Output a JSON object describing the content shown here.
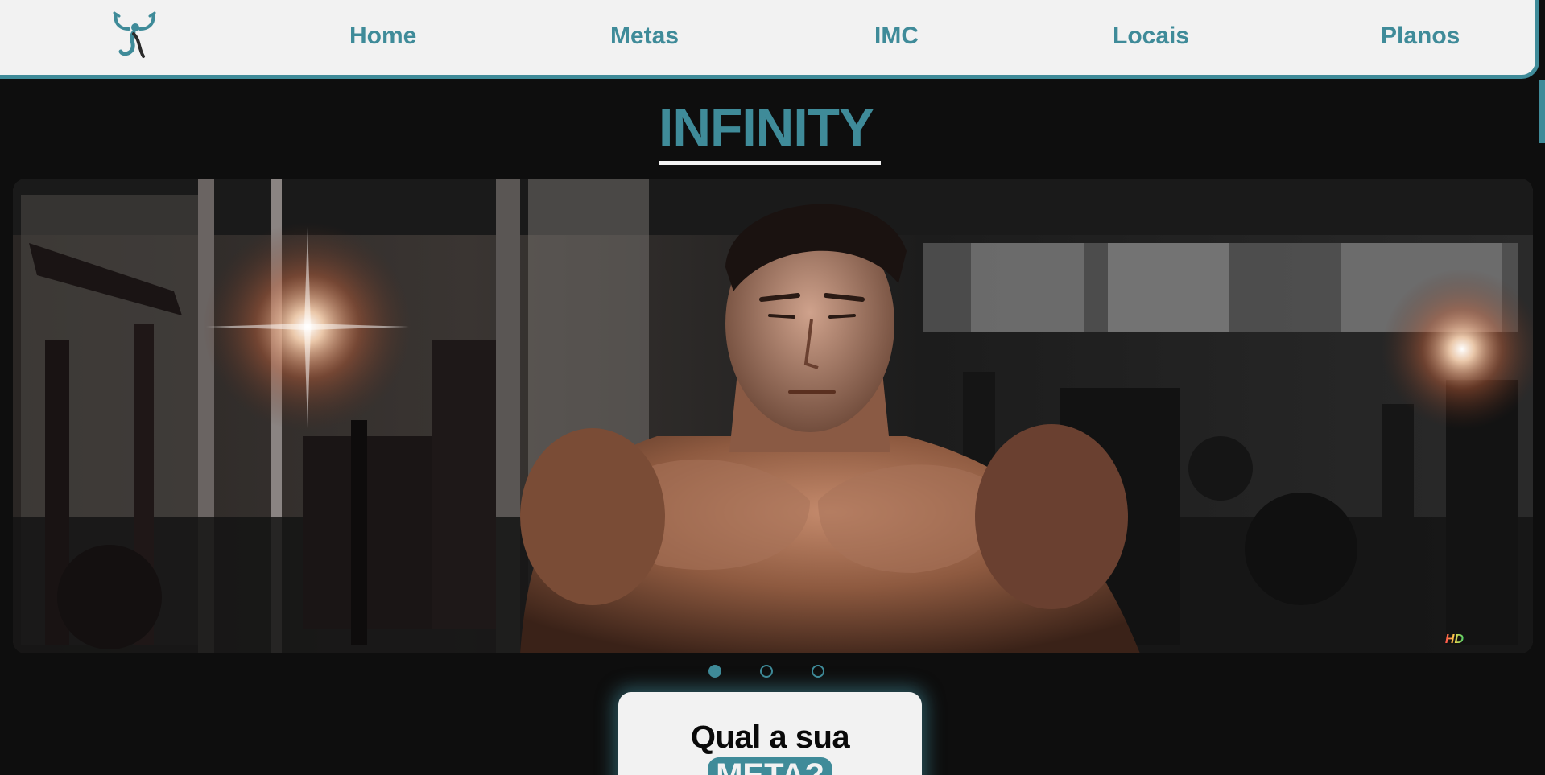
{
  "nav": {
    "logo_icon": "fitness-figure-logo-icon",
    "links": [
      {
        "label": "Home"
      },
      {
        "label": "Metas"
      },
      {
        "label": "IMC"
      },
      {
        "label": "Locais"
      },
      {
        "label": "Planos"
      }
    ]
  },
  "hero": {
    "title": "INFINITY",
    "watermark": "HD"
  },
  "carousel": {
    "slide_count": 3,
    "active_index": 0
  },
  "cta": {
    "line1": "Qual a sua",
    "highlight": "META?"
  },
  "colors": {
    "accent": "#3f8b99",
    "background": "#0e0e0e",
    "surface": "#f2f2f2"
  }
}
